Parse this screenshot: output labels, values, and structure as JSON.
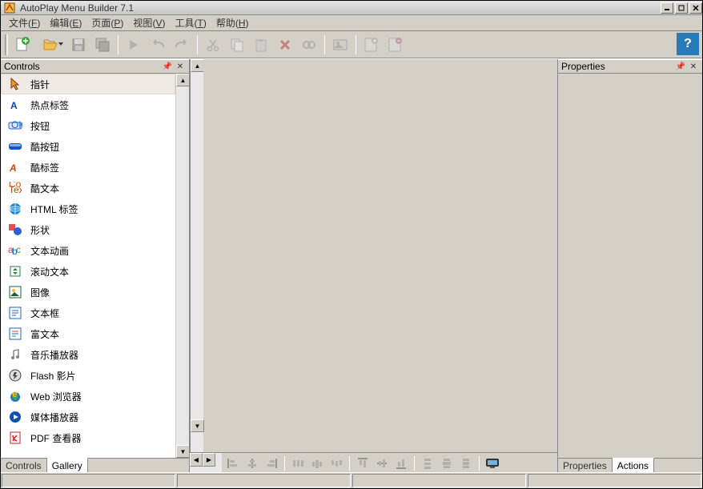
{
  "title": "AutoPlay Menu Builder 7.1",
  "menus": [
    {
      "label": "文件",
      "key": "F"
    },
    {
      "label": "编辑",
      "key": "E"
    },
    {
      "label": "页面",
      "key": "P"
    },
    {
      "label": "视图",
      "key": "V"
    },
    {
      "label": "工具",
      "key": "T"
    },
    {
      "label": "帮助",
      "key": "H"
    }
  ],
  "panels": {
    "controls_title": "Controls",
    "properties_title": "Properties",
    "controls_tab": "Controls",
    "gallery_tab": "Gallery",
    "properties_tab": "Properties",
    "actions_tab": "Actions"
  },
  "controls": [
    {
      "icon": "pointer",
      "label": "指针",
      "color": "#e8a030"
    },
    {
      "icon": "hotspot",
      "label": "热点标签",
      "color": "#1040c0"
    },
    {
      "icon": "button",
      "label": "按钮",
      "color": "#2060c8"
    },
    {
      "icon": "coolbutton",
      "label": "酷按钮",
      "color": "#1058c8"
    },
    {
      "icon": "coollabel",
      "label": "酷标签",
      "color": "#d04010"
    },
    {
      "icon": "cooltext",
      "label": "酷文本",
      "color": "#d06020"
    },
    {
      "icon": "htmllabel",
      "label": "HTML 标签",
      "color": "#2088d0"
    },
    {
      "icon": "shape",
      "label": "形状",
      "color": "#e05050"
    },
    {
      "icon": "textanim",
      "label": "文本动画",
      "color": "#30a030"
    },
    {
      "icon": "scrolltext",
      "label": "滚动文本",
      "color": "#208040"
    },
    {
      "icon": "image",
      "label": "图像",
      "color": "#206030"
    },
    {
      "icon": "textbox",
      "label": "文本框",
      "color": "#2060c0"
    },
    {
      "icon": "richtext",
      "label": "富文本",
      "color": "#2060c0"
    },
    {
      "icon": "music",
      "label": "音乐播放器",
      "color": "#888"
    },
    {
      "icon": "flash",
      "label": "Flash 影片",
      "color": "#444"
    },
    {
      "icon": "browser",
      "label": "Web 浏览器",
      "color": "#2078c8"
    },
    {
      "icon": "media",
      "label": "媒体播放器",
      "color": "#1050b0"
    },
    {
      "icon": "pdf",
      "label": "PDF 查看器",
      "color": "#d02020"
    }
  ]
}
